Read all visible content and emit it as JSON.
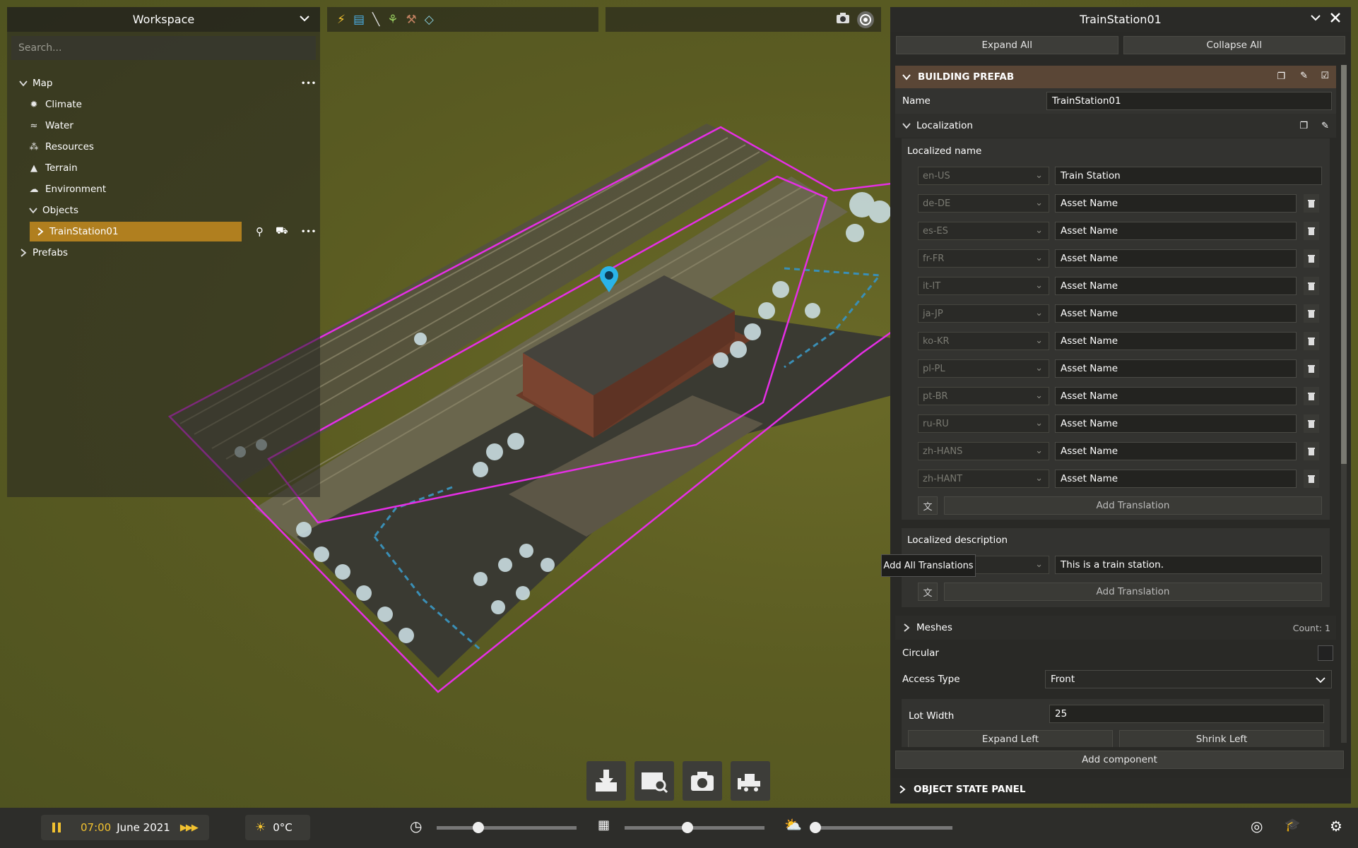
{
  "workspace": {
    "title": "Workspace",
    "search_placeholder": "Search...",
    "tree": {
      "map": "Map",
      "climate": "Climate",
      "water": "Water",
      "resources": "Resources",
      "terrain": "Terrain",
      "environment": "Environment",
      "objects": "Objects",
      "selected_object": "TrainStation01",
      "prefabs": "Prefabs"
    },
    "more_label": "•••"
  },
  "toolbar": {
    "icons": [
      "lightning-icon",
      "eraser-icon",
      "brush-icon",
      "plant-icon",
      "pipe-icon",
      "layers-icon"
    ],
    "glyphs": [
      "⚡",
      "▤",
      "╲",
      "⚘",
      "⚒",
      "◇"
    ]
  },
  "panel": {
    "title": "TrainStation01",
    "expand_all": "Expand All",
    "collapse_all": "Collapse All",
    "building_prefab": "BUILDING PREFAB",
    "name_label": "Name",
    "name_value": "TrainStation01",
    "localization": "Localization",
    "localized_name": "Localized name",
    "locales": [
      {
        "code": "en-US",
        "value": "Train Station"
      },
      {
        "code": "de-DE",
        "value": "Asset Name"
      },
      {
        "code": "es-ES",
        "value": "Asset Name"
      },
      {
        "code": "fr-FR",
        "value": "Asset Name"
      },
      {
        "code": "it-IT",
        "value": "Asset Name"
      },
      {
        "code": "ja-JP",
        "value": "Asset Name"
      },
      {
        "code": "ko-KR",
        "value": "Asset Name"
      },
      {
        "code": "pl-PL",
        "value": "Asset Name"
      },
      {
        "code": "pt-BR",
        "value": "Asset Name"
      },
      {
        "code": "ru-RU",
        "value": "Asset Name"
      },
      {
        "code": "zh-HANS",
        "value": "Asset Name"
      },
      {
        "code": "zh-HANT",
        "value": "Asset Name"
      }
    ],
    "add_translation": "Add Translation",
    "localized_description": "Localized description",
    "description_value": "This is a train station.",
    "tooltip": "Add All Translations",
    "meshes": "Meshes",
    "meshes_count": "Count: 1",
    "circular": "Circular",
    "access_type_label": "Access Type",
    "access_type_value": "Front",
    "lot_width_label": "Lot Width",
    "lot_width_value": "25",
    "expand_left": "Expand Left",
    "shrink_left": "Shrink Left",
    "add_component": "Add component",
    "object_state_panel": "OBJECT STATE PANEL"
  },
  "bottom": {
    "time": "07:00",
    "date": "June 2021",
    "temperature": "0°C",
    "time_slider": 0.3,
    "date_slider": 0.45,
    "weather_slider": 0.02
  },
  "colors": {
    "accent": "#b07f1f",
    "section": "#5a4636",
    "lot_outline": "#e62ee6"
  }
}
